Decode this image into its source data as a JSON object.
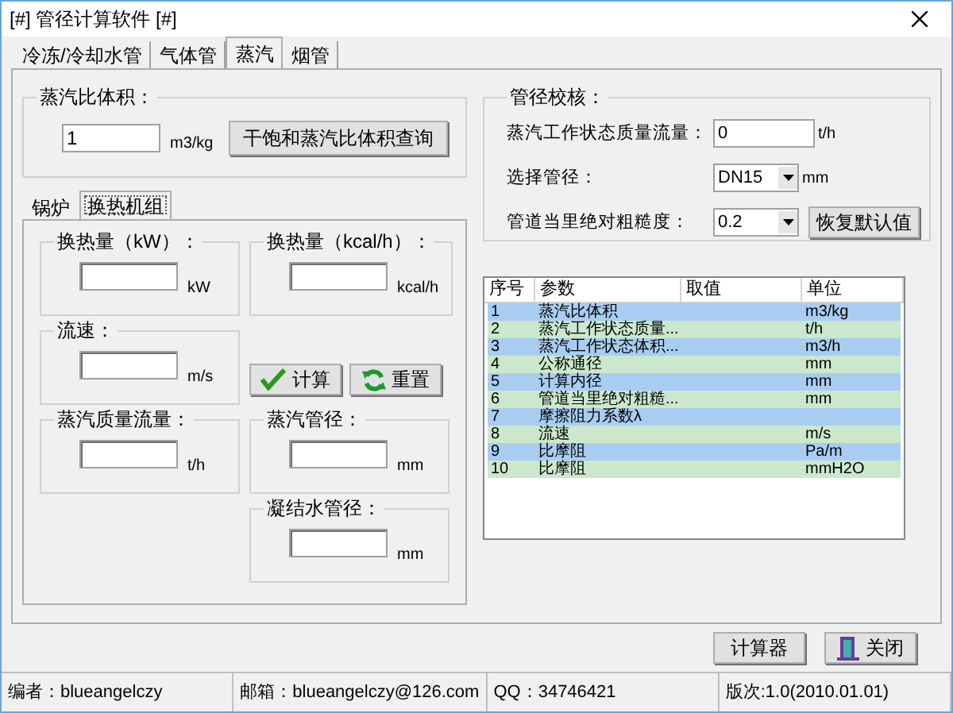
{
  "window": {
    "title": "[#] 管径计算软件 [#]"
  },
  "tabs": [
    {
      "label": "冷冻/冷却水管",
      "selected": false
    },
    {
      "label": "气体管",
      "selected": false
    },
    {
      "label": "蒸汽",
      "selected": true
    },
    {
      "label": "烟管",
      "selected": false
    }
  ],
  "specific_volume": {
    "legend": "蒸汽比体积：",
    "value": "1",
    "unit": "m3/kg",
    "button": "干饱和蒸汽比体积查询"
  },
  "sub_tabs": [
    {
      "label": "锅炉",
      "selected": false
    },
    {
      "label": "换热机组",
      "selected": true
    }
  ],
  "fields": [
    {
      "legend": "换热量（kW）：",
      "unit": "kW"
    },
    {
      "legend": "换热量（kcal/h）：",
      "unit": "kcal/h"
    },
    {
      "legend": "流速：",
      "unit": "m/s"
    },
    {
      "legend": "蒸汽质量流量：",
      "unit": "t/h"
    },
    {
      "legend": "蒸汽管径：",
      "unit": "mm"
    },
    {
      "legend": "凝结水管径：",
      "unit": "mm"
    }
  ],
  "actions": [
    {
      "kind": "calculate",
      "label": "计算"
    },
    {
      "kind": "reset",
      "label": "重置"
    }
  ],
  "check": {
    "legend": "管径校核：",
    "rows": [
      {
        "kind": "input",
        "label": "蒸汽工作状态质量流量：",
        "value": "0",
        "unit": "t/h"
      },
      {
        "kind": "select",
        "label": "选择管径：",
        "value": "DN15",
        "unit": "mm"
      },
      {
        "kind": "select",
        "label": "管道当里绝对粗糙度：",
        "value": "0.2",
        "button": "恢复默认值"
      }
    ]
  },
  "table": {
    "columns": [
      "序号",
      "参数",
      "取值",
      "单位"
    ],
    "rows": [
      {
        "no": "1",
        "param": "蒸汽比体积",
        "unit": "m3/kg"
      },
      {
        "no": "2",
        "param": "蒸汽工作状态质量...",
        "unit": "t/h"
      },
      {
        "no": "3",
        "param": "蒸汽工作状态体积...",
        "unit": "m3/h"
      },
      {
        "no": "4",
        "param": "公称通径",
        "unit": "mm"
      },
      {
        "no": "5",
        "param": "计算内径",
        "unit": "mm"
      },
      {
        "no": "6",
        "param": "管道当里绝对粗糙...",
        "unit": "mm"
      },
      {
        "no": "7",
        "param": "摩擦阻力系数λ"
      },
      {
        "no": "8",
        "param": "流速",
        "unit": "m/s"
      },
      {
        "no": "9",
        "param": "比摩阻",
        "unit": "Pa/m"
      },
      {
        "no": "10",
        "param": "比摩阻",
        "unit": "mmH2O"
      }
    ]
  },
  "buttons": [
    {
      "kind": "calculator",
      "label": "计算器"
    },
    {
      "kind": "close",
      "label": "关闭"
    }
  ],
  "status_bar": [
    "编者：blueangelczy",
    "邮箱：blueangelczy@126.com",
    "QQ：34746421",
    "版次:1.0(2010.01.01)"
  ]
}
